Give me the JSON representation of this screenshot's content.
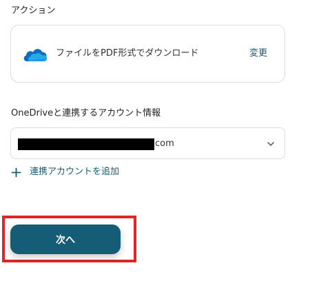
{
  "action_section": {
    "label": "アクション",
    "card": {
      "icon": "onedrive-icon",
      "text": "ファイルをPDF形式でダウンロード",
      "change_label": "変更"
    }
  },
  "account_section": {
    "label": "OneDriveと連携するアカウント情報",
    "selected_value_suffix": "com",
    "add_account_label": "連携アカウントを追加"
  },
  "footer": {
    "next_label": "次へ"
  },
  "colors": {
    "accent": "#155d77",
    "highlight": "#e12424",
    "border": "#d9dce1"
  }
}
